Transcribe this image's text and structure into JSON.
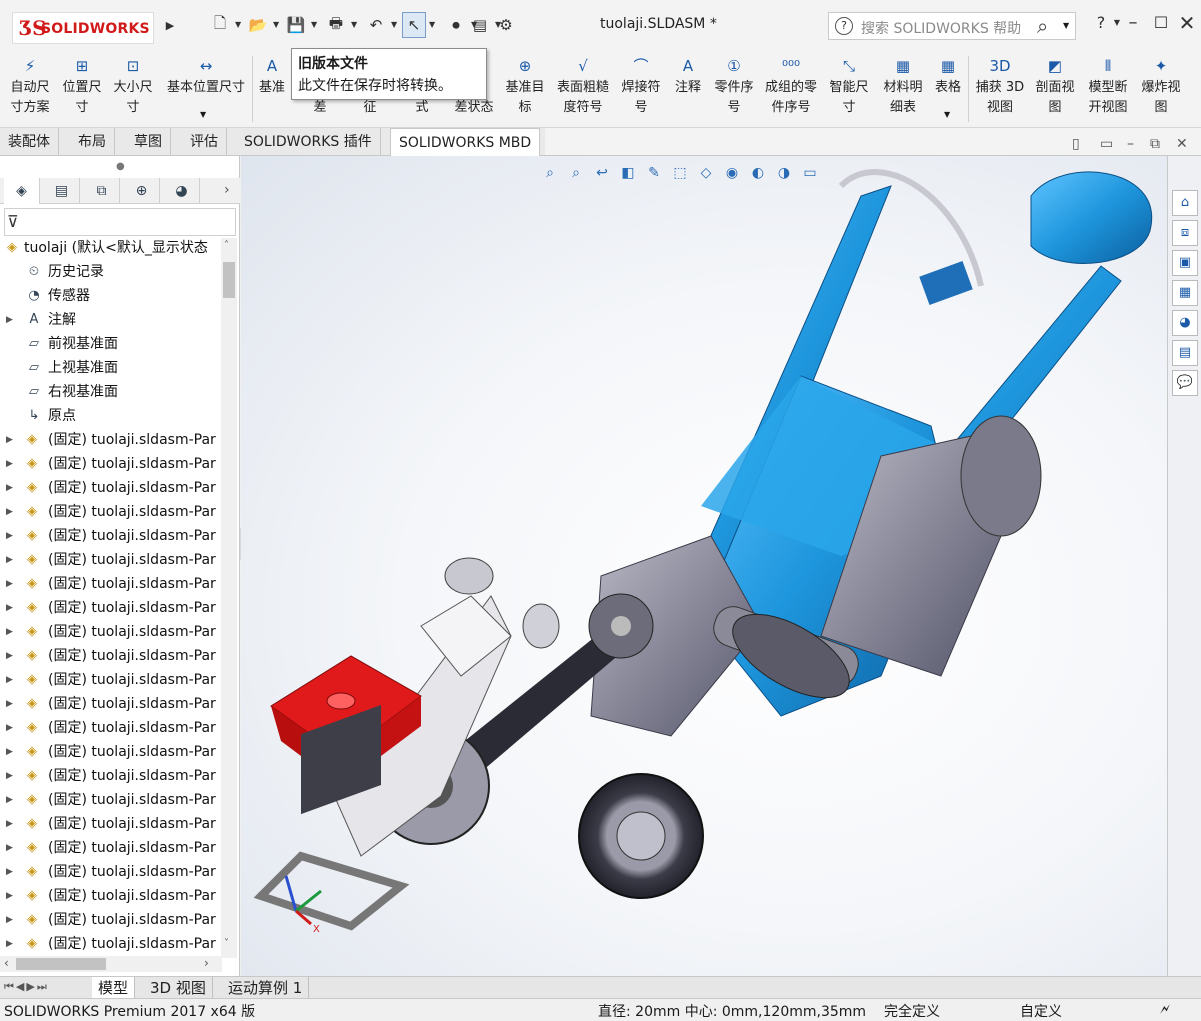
{
  "app": {
    "logo_prefix": "3S",
    "logo_text": "SOLIDWORKS",
    "doc_title": "tuolaji.SLDASM *",
    "search_placeholder": "搜索 SOLIDWORKS 帮助",
    "help_label": "?"
  },
  "quick_access": [
    {
      "name": "new",
      "icon": "new-document-icon",
      "glyph": "🗋"
    },
    {
      "name": "open",
      "icon": "open-folder-icon",
      "glyph": "📂"
    },
    {
      "name": "save",
      "icon": "save-icon",
      "glyph": "💾"
    },
    {
      "name": "print",
      "icon": "printer-icon",
      "glyph": "🖶"
    },
    {
      "name": "undo",
      "icon": "undo-icon",
      "glyph": "↶"
    },
    {
      "name": "select",
      "icon": "select-arrow-icon",
      "glyph": "↖"
    },
    {
      "name": "rebuild",
      "icon": "traffic-light-icon",
      "glyph": "⏺"
    },
    {
      "name": "file-props",
      "icon": "file-properties-icon",
      "glyph": "▤"
    },
    {
      "name": "options",
      "icon": "gear-icon",
      "glyph": "⚙"
    }
  ],
  "ribbon": [
    {
      "label1": "自动尺",
      "label2": "寸方案",
      "icon": "auto-dimension-icon",
      "glyph": "⚡"
    },
    {
      "label1": "位置尺",
      "label2": "寸",
      "icon": "location-dimension-icon",
      "glyph": "⊞"
    },
    {
      "label1": "大小尺",
      "label2": "寸",
      "icon": "size-dimension-icon",
      "glyph": "⊡"
    },
    {
      "label1": "基本位置尺寸",
      "label2": "",
      "icon": "basic-location-dimension-icon",
      "glyph": "↔"
    },
    {
      "label1": "基准",
      "label2": "",
      "icon": "datum-icon",
      "glyph": "A"
    },
    {
      "label1": "",
      "label2": "差",
      "icon": "tolerance-icon",
      "glyph": ""
    },
    {
      "label1": "",
      "label2": "征",
      "icon": "feature-icon",
      "glyph": ""
    },
    {
      "label1": "",
      "label2": "式",
      "icon": "pattern-icon",
      "glyph": ""
    },
    {
      "label1": "公",
      "label2": "差状态",
      "icon": "tolerance-status-icon",
      "glyph": ""
    },
    {
      "label1": "基准目",
      "label2": "标",
      "icon": "datum-target-icon",
      "glyph": "⊕"
    },
    {
      "label1": "表面粗糙",
      "label2": "度符号",
      "icon": "surface-finish-icon",
      "glyph": "√"
    },
    {
      "label1": "焊接符",
      "label2": "号",
      "icon": "weld-symbol-icon",
      "glyph": "⌒"
    },
    {
      "label1": "注释",
      "label2": "",
      "icon": "note-icon",
      "glyph": "A"
    },
    {
      "label1": "零件序",
      "label2": "号",
      "icon": "balloon-icon",
      "glyph": "①"
    },
    {
      "label1": "成组的零",
      "label2": "件序号",
      "icon": "stacked-balloon-icon",
      "glyph": "⁰⁰⁰"
    },
    {
      "label1": "智能尺",
      "label2": "寸",
      "icon": "smart-dimension-icon",
      "glyph": "⤡"
    },
    {
      "label1": "材料明",
      "label2": "细表",
      "icon": "bom-icon",
      "glyph": "▦"
    },
    {
      "label1": "表格",
      "label2": "",
      "icon": "table-icon",
      "glyph": "▦"
    },
    {
      "label1": "捕获 3D",
      "label2": "视图",
      "icon": "capture-3d-view-icon",
      "glyph": "3D"
    },
    {
      "label1": "剖面视",
      "label2": "图",
      "icon": "section-view-icon",
      "glyph": "◩"
    },
    {
      "label1": "模型断",
      "label2": "开视图",
      "icon": "model-break-view-icon",
      "glyph": "⫴"
    },
    {
      "label1": "爆炸视",
      "label2": "图",
      "icon": "exploded-view-icon",
      "glyph": "✦"
    }
  ],
  "tooltip": {
    "title": "旧版本文件",
    "text": "此文件在保存时将转换。"
  },
  "command_tabs": [
    "装配体",
    "布局",
    "草图",
    "评估",
    "SOLIDWORKS 插件",
    "SOLIDWORKS MBD"
  ],
  "active_command_tab": "SOLIDWORKS MBD",
  "panel_tabs": [
    {
      "name": "feature-manager",
      "glyph": "◈"
    },
    {
      "name": "property-manager",
      "glyph": "▤"
    },
    {
      "name": "configuration-manager",
      "glyph": "⧉"
    },
    {
      "name": "dimxpert",
      "glyph": "⊕"
    },
    {
      "name": "display-manager",
      "glyph": "◕"
    }
  ],
  "tree": {
    "root": "tuolaji  (默认<默认_显示状态",
    "items": [
      {
        "label": "历史记录",
        "icon": "history-icon",
        "glyph": "⏲",
        "expand": false
      },
      {
        "label": "传感器",
        "icon": "sensor-icon",
        "glyph": "◔",
        "expand": false
      },
      {
        "label": "注解",
        "icon": "annotation-icon",
        "glyph": "A",
        "expand": true
      },
      {
        "label": "前视基准面",
        "icon": "plane-icon",
        "glyph": "▱",
        "expand": false
      },
      {
        "label": "上视基准面",
        "icon": "plane-icon",
        "glyph": "▱",
        "expand": false
      },
      {
        "label": "右视基准面",
        "icon": "plane-icon",
        "glyph": "▱",
        "expand": false
      },
      {
        "label": "原点",
        "icon": "origin-icon",
        "glyph": "↳",
        "expand": false
      }
    ],
    "part_label": "(固定) tuolaji.sldasm-Par",
    "part_count": 22
  },
  "bottom_tabs": [
    "模型",
    "3D 视图",
    "运动算例 1"
  ],
  "active_bottom_tab": "模型",
  "status": {
    "product": "SOLIDWORKS Premium 2017 x64 版",
    "measure": "直径: 20mm  中心: 0mm,120mm,35mm",
    "state": "完全定义",
    "units": "自定义"
  },
  "hud_icons": [
    "zoom-to-fit-icon",
    "zoom-area-icon",
    "previous-view-icon",
    "section-icon",
    "dynamic-annotation-icon",
    "view-orientation-icon",
    "display-style-icon",
    "hide-show-icon",
    "edit-appearance-icon",
    "apply-scene-icon",
    "view-settings-icon"
  ],
  "task_pane_icons": [
    "home-icon",
    "design-library-icon",
    "file-explorer-icon",
    "view-palette-icon",
    "appearances-icon",
    "custom-properties-icon",
    "forum-icon"
  ],
  "colors": {
    "tractor_blue": "#1f9be0",
    "engine_red": "#e01a1a",
    "frame_gray": "#6b6b78",
    "accent": "#1b5aa8"
  }
}
